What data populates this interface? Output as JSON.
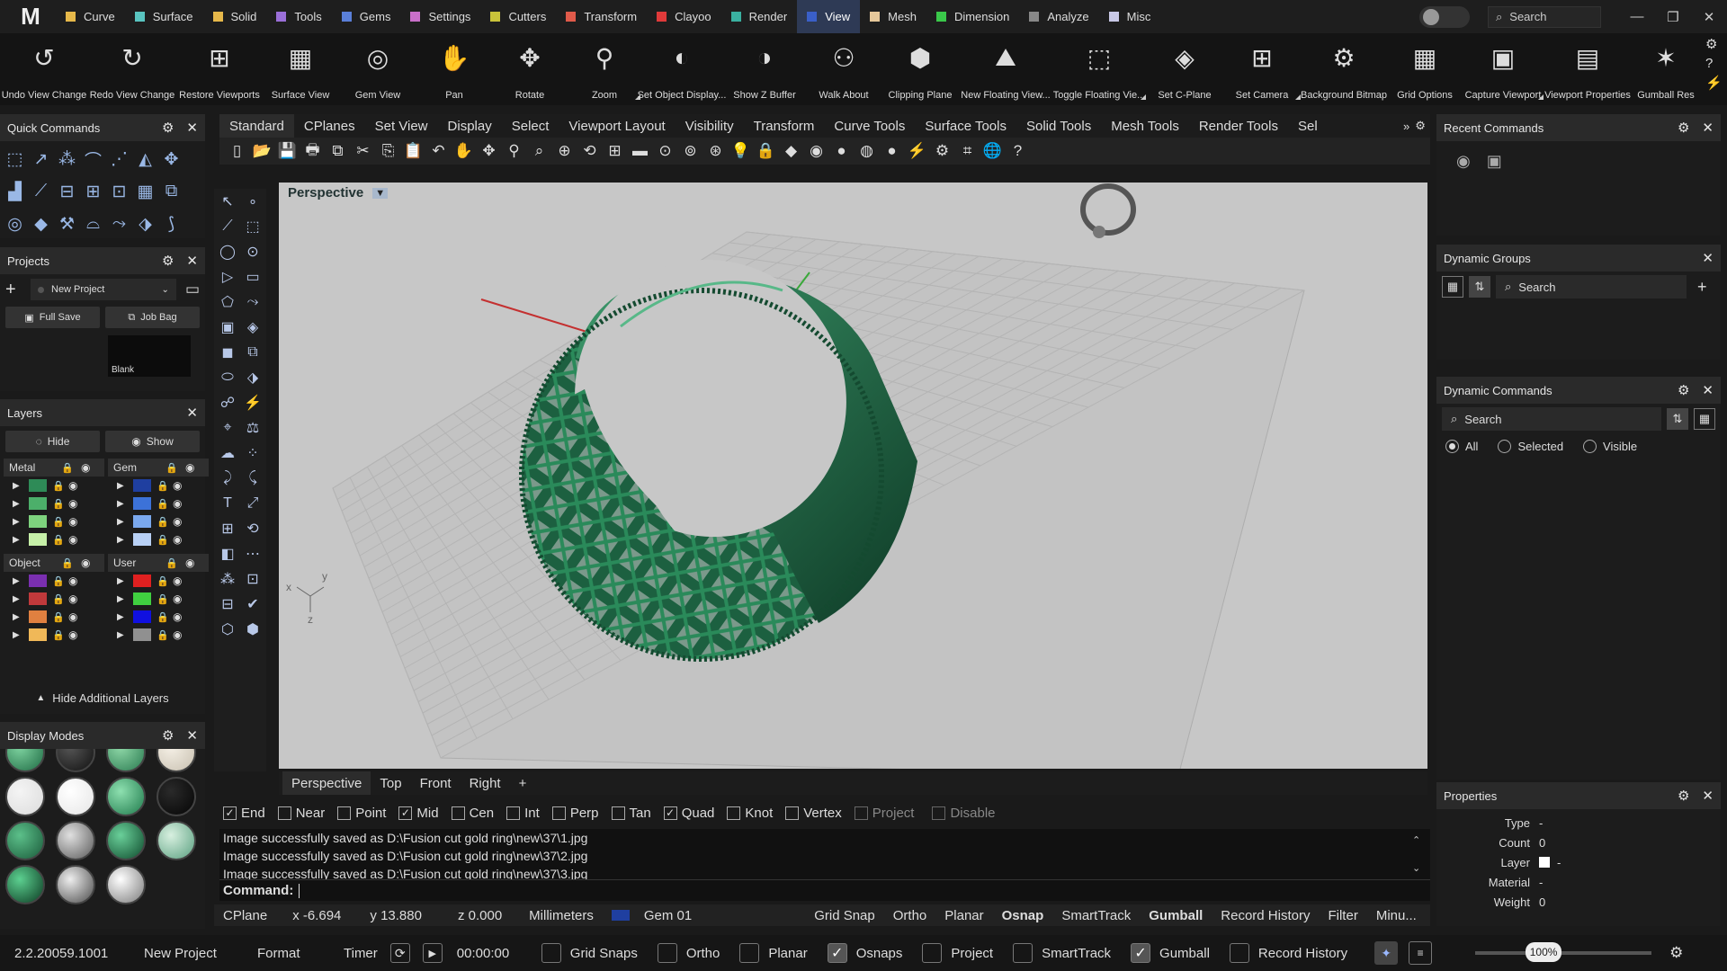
{
  "app": {
    "logo": "M"
  },
  "menu": [
    {
      "label": "Curve",
      "color": "#e6b84a"
    },
    {
      "label": "Surface",
      "color": "#59c4c0"
    },
    {
      "label": "Solid",
      "color": "#e6b84a"
    },
    {
      "label": "Tools",
      "color": "#9a6fd8"
    },
    {
      "label": "Gems",
      "color": "#5a7fd8"
    },
    {
      "label": "Settings",
      "color": "#c86fc8"
    },
    {
      "label": "Cutters",
      "color": "#c9c23a"
    },
    {
      "label": "Transform",
      "color": "#e05a4a"
    },
    {
      "label": "Clayoo",
      "color": "#e03a3a"
    },
    {
      "label": "Render",
      "color": "#3ab0a0"
    },
    {
      "label": "View",
      "color": "#3a5fc8",
      "active": true
    },
    {
      "label": "Mesh",
      "color": "#e6c89a"
    },
    {
      "label": "Dimension",
      "color": "#3ac84a"
    },
    {
      "label": "Analyze",
      "color": "#888888"
    },
    {
      "label": "Misc",
      "color": "#c8c8e6"
    }
  ],
  "top_search": "Search",
  "ribbon": [
    {
      "label": "Undo View Change",
      "icon": "↺",
      "w": 98
    },
    {
      "label": "Redo View Change",
      "icon": "↻",
      "w": 98
    },
    {
      "label": "Restore Viewports",
      "icon": "⊞",
      "w": 96
    },
    {
      "label": "Surface View",
      "icon": "▦",
      "w": 84
    },
    {
      "label": "Gem View",
      "icon": "◎",
      "w": 88
    },
    {
      "label": "Pan",
      "icon": "✋",
      "w": 82
    },
    {
      "label": "Rotate",
      "icon": "✥",
      "w": 86
    },
    {
      "label": "Zoom",
      "icon": "⚲",
      "w": 80,
      "corner": true
    },
    {
      "label": "Set Object Display...",
      "icon": "◐",
      "w": 92
    },
    {
      "label": "Show Z Buffer",
      "icon": "◑",
      "w": 92
    },
    {
      "label": "Walk About",
      "icon": "⚇",
      "w": 84
    },
    {
      "label": "Clipping Plane",
      "icon": "⬢",
      "w": 86
    },
    {
      "label": "New Floating View...",
      "icon": "⛰",
      "w": 104
    },
    {
      "label": "Toggle Floating Vie...",
      "icon": "⬚",
      "w": 104,
      "corner": true
    },
    {
      "label": "Set C-Plane",
      "icon": "◈",
      "w": 86
    },
    {
      "label": "Set Camera",
      "icon": "⊞",
      "w": 86,
      "corner": true
    },
    {
      "label": "Background Bitmap",
      "icon": "⚙",
      "w": 96
    },
    {
      "label": "Grid Options",
      "icon": "▦",
      "w": 84
    },
    {
      "label": "Capture Viewport",
      "icon": "▣",
      "w": 90,
      "corner": true
    },
    {
      "label": "Viewport Properties",
      "icon": "▤",
      "w": 98
    },
    {
      "label": "Gumball Res",
      "icon": "✶",
      "w": 76
    }
  ],
  "quick_commands": {
    "title": "Quick Commands",
    "icons": [
      "⬚",
      "↗",
      "⁂",
      "⌒",
      "⋰",
      "◭",
      "✥",
      "▟",
      "⟋",
      "⊟",
      "⊞",
      "⊡",
      "▦",
      "⧉",
      "◎",
      "◆",
      "⚒",
      "⌓",
      "⤳",
      "⬗",
      "⟆"
    ]
  },
  "projects": {
    "title": "Projects",
    "dropdown": "New Project",
    "full_save": "Full Save",
    "job_bag": "Job Bag",
    "thumb_label": "Blank"
  },
  "layers": {
    "title": "Layers",
    "hide": "Hide",
    "show": "Show",
    "groups": [
      {
        "name": "Metal",
        "colors": [
          "#2e8b57",
          "#4caf6a",
          "#7ed37e",
          "#c6f0a8"
        ]
      },
      {
        "name": "Gem",
        "colors": [
          "#1f3fa0",
          "#3c72d8",
          "#7aa8ee",
          "#b8d0f5"
        ]
      },
      {
        "name": "Object",
        "colors": [
          "#7a2fb0",
          "#c0393b",
          "#e08040",
          "#f0b858"
        ]
      },
      {
        "name": "User",
        "colors": [
          "#e02020",
          "#40d040",
          "#1010e0",
          "#909090"
        ]
      }
    ],
    "hide_additional": "Hide Additional Layers"
  },
  "display_modes": {
    "title": "Display Modes",
    "balls": [
      "radial-gradient(circle at 35% 35%,#7ed3a0,#1f6b44)",
      "radial-gradient(circle at 35% 35%,#555,#111)",
      "radial-gradient(circle at 35% 35%,#8fd8a8,#2a7a50)",
      "radial-gradient(circle at 35% 35%,#f5f0e6,#c8c0b0)",
      "radial-gradient(circle at 35% 35%,#f4f4f4,#dcdcdc)",
      "radial-gradient(circle at 35% 35%,#ffffff,#e6e6e6)",
      "radial-gradient(circle at 35% 35%,#8ee0b0,#1f7a4c)",
      "radial-gradient(circle at 35% 35%,#2a2a2a,#050505)",
      "radial-gradient(circle at 35% 35%,#5cc08a,#1a5a3a)",
      "radial-gradient(circle at 35% 35%,#e0e0e0,#5a5a5a)",
      "radial-gradient(circle at 35% 35%,#6ad09a,#0e4a2c)",
      "radial-gradient(circle at 35% 35%,#d8f0e0,#5aa080)",
      "radial-gradient(circle at 35% 35%,#5cd090,#0c3a22)",
      "radial-gradient(circle at 35% 35%,#eeeeee,#4a4a4a)",
      "radial-gradient(circle at 35% 35%,#ffffff,#7a7a7a)"
    ]
  },
  "tool_tabs": [
    "Standard",
    "CPlanes",
    "Set View",
    "Display",
    "Select",
    "Viewport Layout",
    "Visibility",
    "Transform",
    "Curve Tools",
    "Surface Tools",
    "Solid Tools",
    "Mesh Tools",
    "Render Tools",
    "Sel"
  ],
  "iconbar": [
    "▯",
    "📂",
    "💾",
    "🖶",
    "⧉",
    "✂",
    "⎘",
    "📋",
    "↶",
    "✋",
    "✥",
    "⚲",
    "⌕",
    "⊕",
    "⟲",
    "⊞",
    "▬",
    "⊙",
    "⊚",
    "⊛",
    "💡",
    "🔒",
    "◆",
    "◉",
    "●",
    "◍",
    "●",
    "⚡",
    "⚙",
    "⌗",
    "🌐",
    "?"
  ],
  "viewport": {
    "label": "Perspective",
    "axis": [
      "x",
      "y",
      "z"
    ]
  },
  "vtools": [
    "↖",
    "∘",
    "⟋",
    "⬚",
    "◯",
    "⊙",
    "▷",
    "▭",
    "⬠",
    "⤳",
    "▣",
    "◈",
    "◼",
    "⧉",
    "⬭",
    "⬗",
    "☍",
    "⚡",
    "⌖",
    "⚖",
    "☁",
    "⁘",
    "⤸",
    "⤹",
    "T",
    "⤢",
    "⊞",
    "⟲",
    "◧",
    "⋯",
    "⁂",
    "⊡",
    "⊟",
    "✔",
    "⬡",
    "⬢"
  ],
  "vp_tabs": [
    "Perspective",
    "Top",
    "Front",
    "Right",
    "+"
  ],
  "osnaps": [
    {
      "label": "End",
      "checked": true
    },
    {
      "label": "Near",
      "checked": false
    },
    {
      "label": "Point",
      "checked": false
    },
    {
      "label": "Mid",
      "checked": true
    },
    {
      "label": "Cen",
      "checked": false
    },
    {
      "label": "Int",
      "checked": false
    },
    {
      "label": "Perp",
      "checked": false
    },
    {
      "label": "Tan",
      "checked": false
    },
    {
      "label": "Quad",
      "checked": true
    },
    {
      "label": "Knot",
      "checked": false
    },
    {
      "label": "Vertex",
      "checked": false
    },
    {
      "label": "Project",
      "checked": false,
      "disabled": true
    },
    {
      "label": "Disable",
      "checked": false,
      "disabled": true
    }
  ],
  "command_history": [
    "Image successfully saved as D:\\Fusion cut gold ring\\new\\37\\1.jpg",
    "Image successfully saved as D:\\Fusion cut gold ring\\new\\37\\2.jpg",
    "Image successfully saved as D:\\Fusion cut gold ring\\new\\37\\3.jpg"
  ],
  "command_prompt": "Command:",
  "status": {
    "cplane": "CPlane",
    "x": "x -6.694",
    "y": "y 13.880",
    "z": "z 0.000",
    "units": "Millimeters",
    "layer": "Gem 01",
    "layer_color": "#1f3fa0",
    "toggles": [
      "Grid Snap",
      "Ortho",
      "Planar",
      "Osnap",
      "SmartTrack",
      "Gumball",
      "Record History",
      "Filter",
      "Minu..."
    ]
  },
  "bottom": {
    "version": "2.2.20059.1001",
    "project": "New Project",
    "format": "Format",
    "timer": "Timer",
    "time": "00:00:00",
    "checks": [
      {
        "label": "Grid Snaps",
        "checked": false
      },
      {
        "label": "Ortho",
        "checked": false
      },
      {
        "label": "Planar",
        "checked": false
      },
      {
        "label": "Osnaps",
        "checked": true
      },
      {
        "label": "Project",
        "checked": false
      },
      {
        "label": "SmartTrack",
        "checked": false
      },
      {
        "label": "Gumball",
        "checked": true
      },
      {
        "label": "Record History",
        "checked": false
      }
    ],
    "zoom": "100%"
  },
  "recent_commands": {
    "title": "Recent Commands"
  },
  "dynamic_groups": {
    "title": "Dynamic Groups",
    "search": "Search"
  },
  "dynamic_commands": {
    "title": "Dynamic Commands",
    "search": "Search",
    "radios": [
      {
        "label": "All",
        "checked": true
      },
      {
        "label": "Selected",
        "checked": false
      },
      {
        "label": "Visible",
        "checked": false
      }
    ]
  },
  "properties": {
    "title": "Properties",
    "rows": [
      {
        "k": "Type",
        "v": "-"
      },
      {
        "k": "Count",
        "v": "0"
      },
      {
        "k": "Layer",
        "v": "-"
      },
      {
        "k": "Material",
        "v": "-"
      },
      {
        "k": "Weight",
        "v": "0"
      }
    ]
  }
}
